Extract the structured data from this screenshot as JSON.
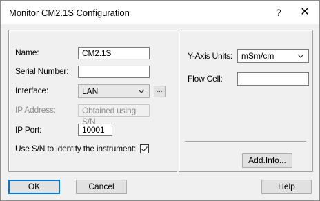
{
  "window": {
    "title": "Monitor CM2.1S Configuration",
    "help_glyph": "?",
    "close_glyph": "✕"
  },
  "left_panel": {
    "name": {
      "label": "Name:",
      "value": "CM2.1S"
    },
    "serial": {
      "label": "Serial Number:",
      "value": ""
    },
    "interface": {
      "label": "Interface:",
      "value": "LAN",
      "browse_label": "..."
    },
    "ip_address": {
      "label": "IP Address:",
      "value": "Obtained using S/N",
      "enabled": false
    },
    "ip_port": {
      "label": "IP Port:",
      "value": "10001"
    },
    "use_sn": {
      "label": "Use S/N to identify the instrument:",
      "checked": true
    }
  },
  "right_panel": {
    "y_axis": {
      "label": "Y-Axis Units:",
      "value": "mSm/cm"
    },
    "flow_cell": {
      "label": "Flow Cell:",
      "value": ""
    },
    "add_info_label": "Add.Info..."
  },
  "footer": {
    "ok_label": "OK",
    "cancel_label": "Cancel",
    "help_label": "Help"
  },
  "icons": {
    "dropdown": "chevron-down-icon",
    "checkbox": "checkmark-icon",
    "close": "close-icon"
  },
  "colors": {
    "dialog_bg": "#f0f0f0",
    "focus_border": "#0078d7"
  }
}
